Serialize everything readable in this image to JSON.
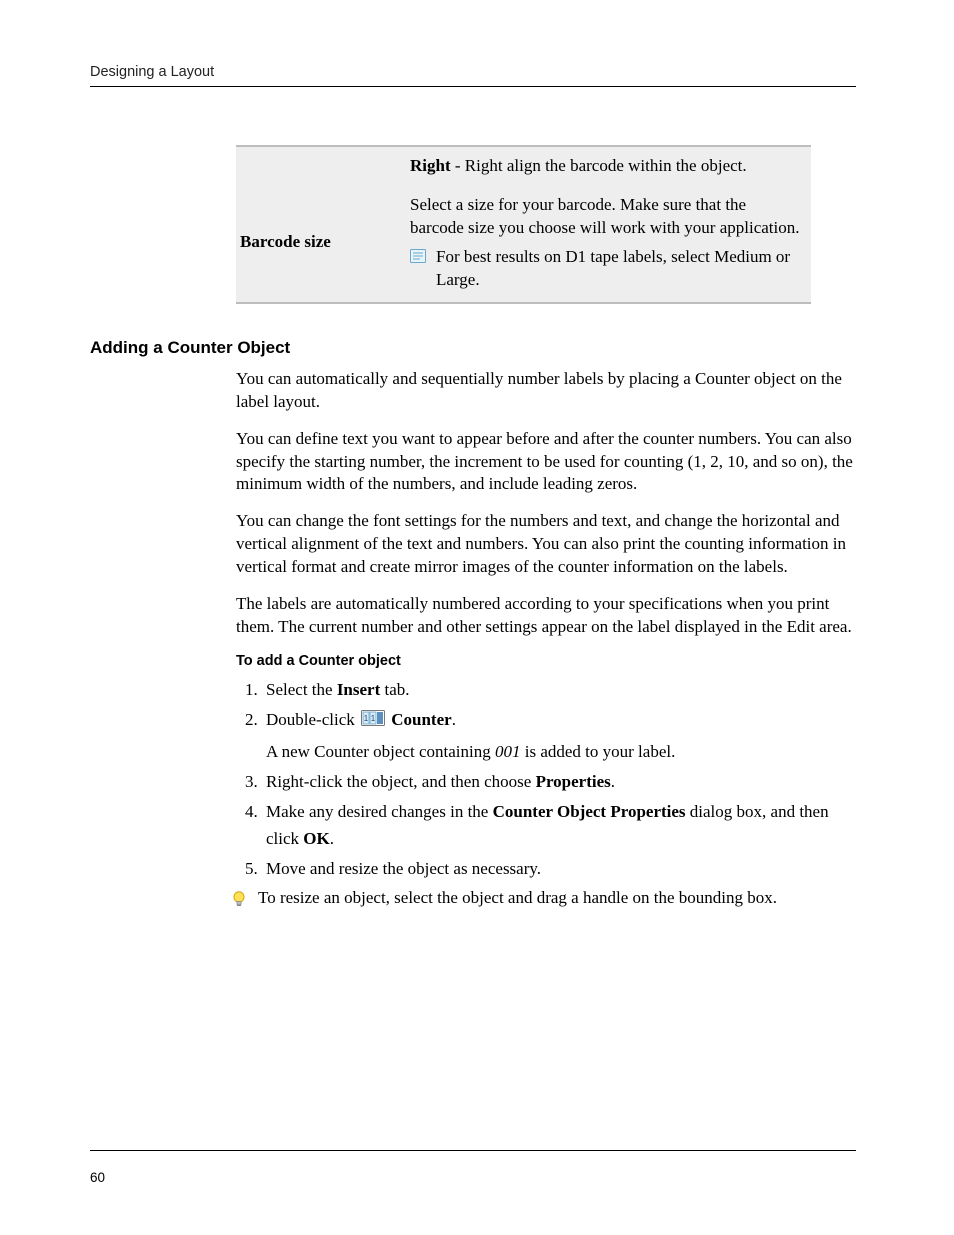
{
  "header": {
    "running_head": "Designing a Layout"
  },
  "table": {
    "row1": {
      "desc_prefix_bold": "Right",
      "desc_rest": " - Right align the barcode within the object."
    },
    "row2": {
      "label": "Barcode size",
      "desc": "Select a size for your barcode. Make sure that the barcode size you choose will work with your application.",
      "note": "For best results on D1 tape labels, select Medium or Large."
    }
  },
  "section": {
    "heading": "Adding a Counter Object",
    "p1": "You can automatically and sequentially number labels by placing a Counter object on the label layout.",
    "p2": "You can define text you want to appear before and after the counter numbers. You can also specify the starting number, the increment to be used for counting (1, 2, 10, and so on), the minimum width of the numbers, and include leading zeros.",
    "p3": "You can change the font settings for the numbers and text, and change the horizontal and vertical alignment of the text and numbers. You can also print the counting information in vertical format and create mirror images of the counter information on the labels.",
    "p4": "The labels are automatically numbered according to your specifications when you print them. The current number and other settings appear on the label displayed in the Edit area.",
    "procedure_title": "To add a Counter object",
    "steps": {
      "s1_pre": "Select the ",
      "s1_bold": "Insert",
      "s1_post": " tab.",
      "s2_pre": "Double-click ",
      "s2_icon_name": "counter-icon",
      "s2_bold": " Counter",
      "s2_post": ".",
      "s2_sub_pre": "A new Counter object containing ",
      "s2_sub_ital": "001",
      "s2_sub_post": " is added to your label.",
      "s3_pre": "Right-click the object, and then choose ",
      "s3_bold": "Properties",
      "s3_post": ".",
      "s4_pre": "Make any desired changes in the ",
      "s4_bold": "Counter Object Properties",
      "s4_mid": " dialog box, and then click ",
      "s4_bold2": "OK",
      "s4_post": ".",
      "s5": "Move and resize the object as necessary."
    },
    "tip": "To resize an object, select the object and drag a handle on the bounding box."
  },
  "footer": {
    "page_number": "60"
  }
}
